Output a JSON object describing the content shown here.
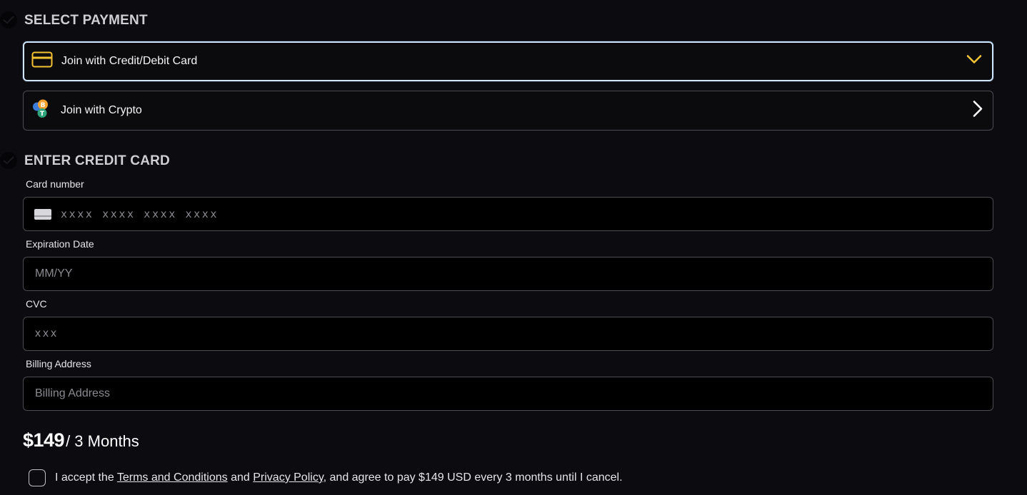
{
  "payment_section": {
    "title": "SELECT PAYMENT",
    "options": [
      {
        "label": "Join with Credit/Debit Card",
        "icon": "credit-card-icon",
        "state": "expanded"
      },
      {
        "label": "Join with Crypto",
        "icon": "crypto-coins-icon",
        "state": "collapsed"
      }
    ]
  },
  "card_section": {
    "title": "ENTER CREDIT CARD",
    "fields": {
      "card_number": {
        "label": "Card number",
        "placeholder": "xxxx xxxx xxxx xxxx",
        "value": ""
      },
      "expiration": {
        "label": "Expiration Date",
        "placeholder": "MM/YY",
        "value": ""
      },
      "cvc": {
        "label": "CVC",
        "placeholder": "xxx",
        "value": ""
      },
      "billing": {
        "label": "Billing Address",
        "placeholder": "Billing Address",
        "value": ""
      }
    }
  },
  "pricing": {
    "amount": "$149",
    "period": "/ 3 Months"
  },
  "terms": {
    "prefix": "I accept the",
    "terms_link": "Terms and Conditions",
    "and": "and",
    "privacy_link": "Privacy Policy",
    "suffix": ", and agree to pay $149 USD every 3 months until I cancel.",
    "checked": false
  },
  "colors": {
    "accent": "#f2c230",
    "background": "#0c0b10",
    "field_border": "#4a4a50",
    "active_border": "#cfe6ff"
  }
}
